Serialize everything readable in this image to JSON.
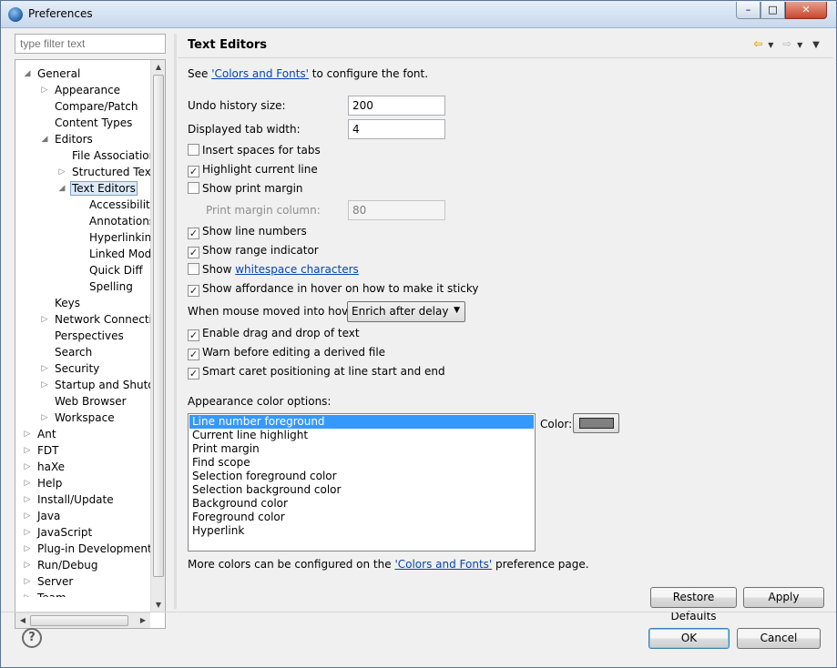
{
  "window": {
    "title": "Preferences"
  },
  "titlebar": {
    "min": "–",
    "max": "□",
    "close": "✕"
  },
  "filter": {
    "placeholder": "type filter text"
  },
  "tree": [
    {
      "label": "General",
      "level": 0,
      "tw": "◢"
    },
    {
      "label": "Appearance",
      "level": 1,
      "tw": "▷"
    },
    {
      "label": "Compare/Patch",
      "level": 1,
      "tw": ""
    },
    {
      "label": "Content Types",
      "level": 1,
      "tw": ""
    },
    {
      "label": "Editors",
      "level": 1,
      "tw": "◢"
    },
    {
      "label": "File Associations",
      "level": 2,
      "tw": ""
    },
    {
      "label": "Structured Text E",
      "level": 2,
      "tw": "▷"
    },
    {
      "label": "Text Editors",
      "level": 2,
      "tw": "◢",
      "selected": true
    },
    {
      "label": "Accessibility",
      "level": 3,
      "tw": ""
    },
    {
      "label": "Annotations",
      "level": 3,
      "tw": ""
    },
    {
      "label": "Hyperlinking",
      "level": 3,
      "tw": ""
    },
    {
      "label": "Linked Mode",
      "level": 3,
      "tw": ""
    },
    {
      "label": "Quick Diff",
      "level": 3,
      "tw": ""
    },
    {
      "label": "Spelling",
      "level": 3,
      "tw": ""
    },
    {
      "label": "Keys",
      "level": 1,
      "tw": ""
    },
    {
      "label": "Network Connection",
      "level": 1,
      "tw": "▷"
    },
    {
      "label": "Perspectives",
      "level": 1,
      "tw": ""
    },
    {
      "label": "Search",
      "level": 1,
      "tw": ""
    },
    {
      "label": "Security",
      "level": 1,
      "tw": "▷"
    },
    {
      "label": "Startup and Shutdow",
      "level": 1,
      "tw": "▷"
    },
    {
      "label": "Web Browser",
      "level": 1,
      "tw": ""
    },
    {
      "label": "Workspace",
      "level": 1,
      "tw": "▷"
    },
    {
      "label": "Ant",
      "level": 0,
      "tw": "▷"
    },
    {
      "label": "FDT",
      "level": 0,
      "tw": "▷"
    },
    {
      "label": "haXe",
      "level": 0,
      "tw": "▷"
    },
    {
      "label": "Help",
      "level": 0,
      "tw": "▷"
    },
    {
      "label": "Install/Update",
      "level": 0,
      "tw": "▷"
    },
    {
      "label": "Java",
      "level": 0,
      "tw": "▷"
    },
    {
      "label": "JavaScript",
      "level": 0,
      "tw": "▷"
    },
    {
      "label": "Plug-in Development",
      "level": 0,
      "tw": "▷"
    },
    {
      "label": "Run/Debug",
      "level": 0,
      "tw": "▷"
    },
    {
      "label": "Server",
      "level": 0,
      "tw": "▷"
    },
    {
      "label": "Team",
      "level": 0,
      "tw": "▷"
    }
  ],
  "page": {
    "title": "Text Editors",
    "intro_before": "See ",
    "intro_link": "'Colors and Fonts'",
    "intro_after": " to configure the font.",
    "undo_label": "Undo history size:",
    "undo_value": "200",
    "tab_label": "Displayed tab width:",
    "tab_value": "4",
    "opt_insert_spaces": "Insert spaces for tabs",
    "opt_highlight_line": "Highlight current line",
    "opt_print_margin": "Show print margin",
    "margin_col_label": "Print margin column:",
    "margin_col_value": "80",
    "opt_line_numbers": "Show line numbers",
    "opt_range_indicator": "Show range indicator",
    "opt_whitespace_pre": "Show ",
    "opt_whitespace_link": "whitespace characters",
    "opt_affordance": "Show affordance in hover on how to make it sticky",
    "hover_label": "When mouse moved into hover:",
    "hover_value": "Enrich after delay",
    "opt_drag_drop": "Enable drag and drop of text",
    "opt_warn_derived": "Warn before editing a derived file",
    "opt_smart_caret": "Smart caret positioning at line start and end",
    "color_options_label": "Appearance color options:",
    "color_items": [
      "Line number foreground",
      "Current line highlight",
      "Print margin",
      "Find scope",
      "Selection foreground color",
      "Selection background color",
      "Background color",
      "Foreground color",
      "Hyperlink"
    ],
    "color_label": "Color:",
    "color_swatch": "#808080",
    "more_before": "More colors can be configured on the ",
    "more_link": "'Colors and Fonts'",
    "more_after": " preference page.",
    "restore_defaults": "Restore Defaults",
    "apply": "Apply"
  },
  "checks": {
    "insert_spaces": false,
    "highlight_line": true,
    "print_margin": false,
    "line_numbers": true,
    "range_indicator": true,
    "whitespace": false,
    "affordance": true,
    "drag_drop": true,
    "warn_derived": true,
    "smart_caret": true
  },
  "footer": {
    "help": "?",
    "ok": "OK",
    "cancel": "Cancel"
  },
  "icons": {
    "back": "arrow-left-icon",
    "forward": "arrow-right-icon",
    "menu": "view-menu-icon"
  }
}
